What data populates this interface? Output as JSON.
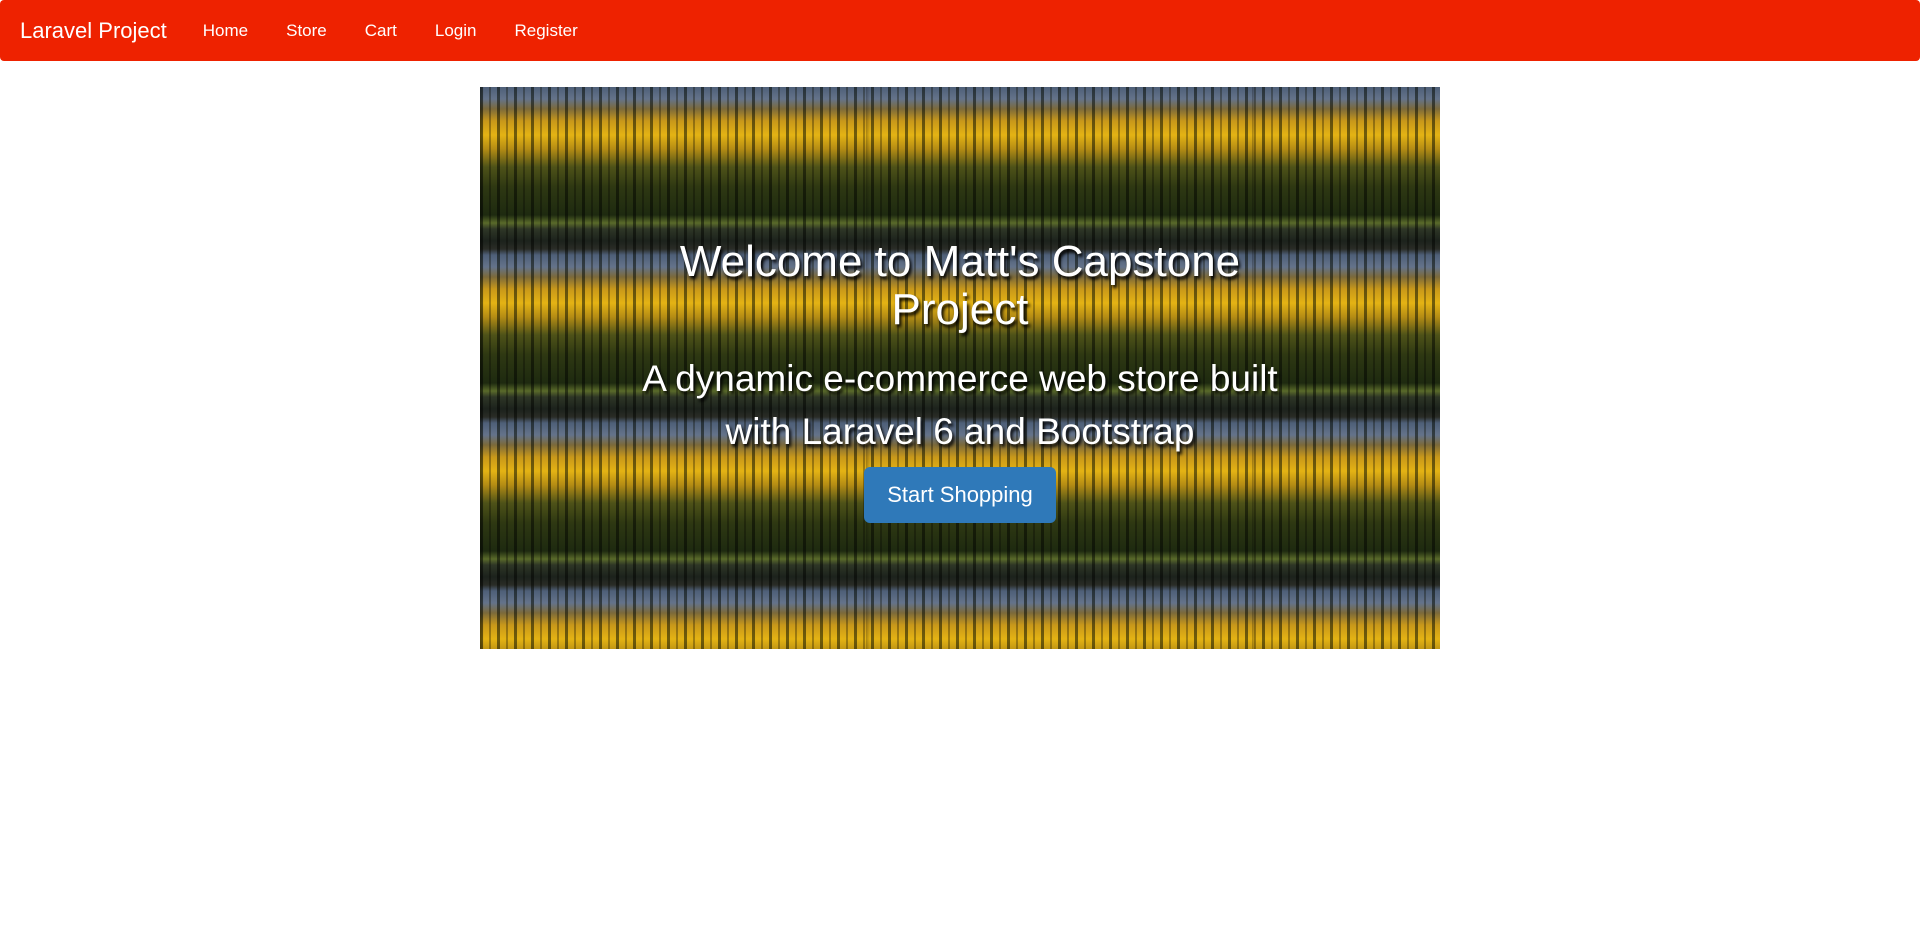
{
  "navbar": {
    "brand": "Laravel Project",
    "links": [
      "Home",
      "Store",
      "Cart",
      "Login",
      "Register"
    ],
    "color": "#ee2200"
  },
  "hero": {
    "title_lines": [
      "Welcome to Matt's Capstone",
      "Project"
    ],
    "subtitle_lines": [
      "A dynamic e-commerce web store built",
      "with Laravel 6 and Bootstrap"
    ],
    "cta_label": "Start Shopping",
    "cta_color": "#2f79b9"
  }
}
